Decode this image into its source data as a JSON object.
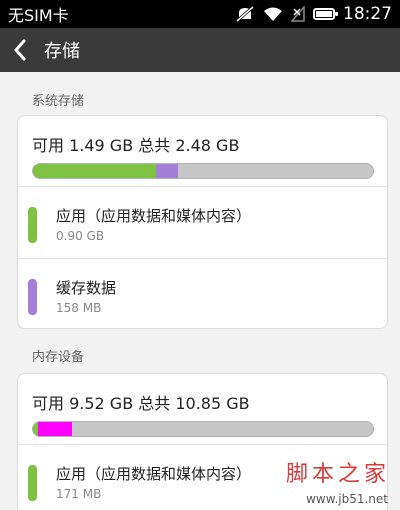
{
  "status_bar": {
    "carrier": "无SIM卡",
    "time": "18:27",
    "icons": [
      "mute-icon",
      "wifi-icon",
      "signal-icon",
      "battery-icon"
    ]
  },
  "action_bar": {
    "title": "存储",
    "back_icon": "chevron-left-icon"
  },
  "system_storage": {
    "section_label": "系统存储",
    "summary": "可用 1.49 GB  总共 2.48 GB",
    "bar": [
      {
        "name": "apps",
        "fraction": 0.363,
        "color": "#7dc242"
      },
      {
        "name": "cache",
        "fraction": 0.064,
        "color": "#a57fd6"
      }
    ],
    "rows": [
      {
        "title": "应用（应用数据和媒体内容）",
        "size": "0.90 GB",
        "color": "#7dc242"
      },
      {
        "title": "缓存数据",
        "size": "158 MB",
        "color": "#a57fd6"
      }
    ]
  },
  "internal_storage": {
    "section_label": "内存设备",
    "summary": "可用 9.52 GB  总共 10.85 GB",
    "bar": [
      {
        "name": "apps",
        "fraction": 0.016,
        "color": "#7dc242"
      },
      {
        "name": "other",
        "fraction": 0.1,
        "color": "#ff00ff"
      }
    ],
    "rows": [
      {
        "title": "应用（应用数据和媒体内容）",
        "size": "171 MB",
        "color": "#7dc242"
      }
    ]
  },
  "watermark": {
    "text": "脚本之家",
    "url": "www.jb51.net"
  }
}
